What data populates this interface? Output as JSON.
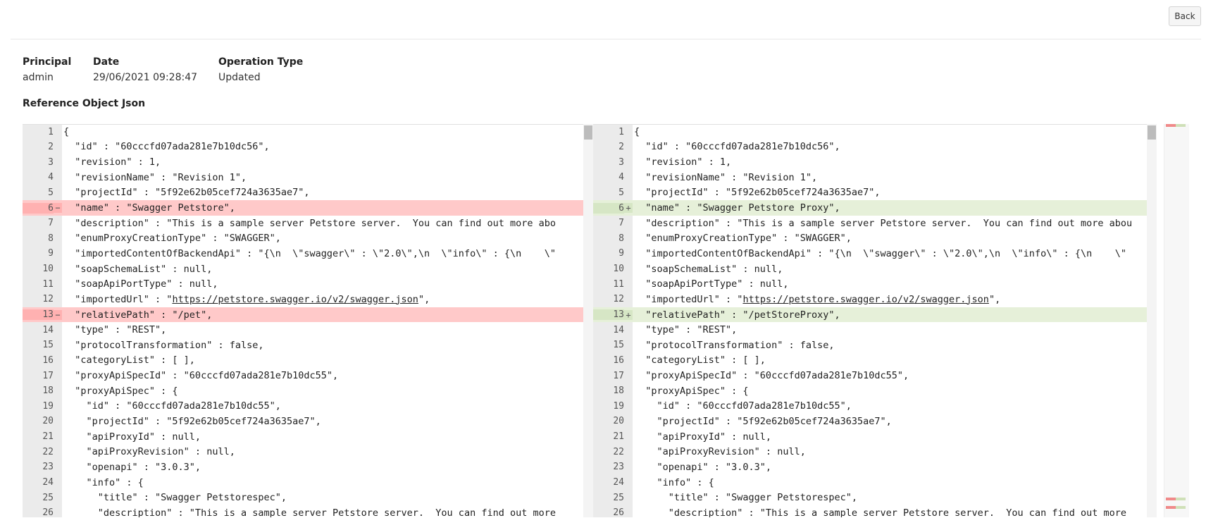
{
  "header": {
    "back_label": "Back"
  },
  "meta": {
    "principal_label": "Principal",
    "principal_value": "admin",
    "date_label": "Date",
    "date_value": "29/06/2021 09:28:47",
    "op_label": "Operation Type",
    "op_value": "Updated"
  },
  "section_title": "Reference Object Json",
  "colors": {
    "removed_bg": "#ffc9c9",
    "added_bg": "#e6f0d9",
    "gutter_bg": "#ebebeb"
  },
  "diff": {
    "left": [
      {
        "n": "1",
        "code": "{",
        "state": ""
      },
      {
        "n": "2",
        "code": "  \"id\" : \"60cccfd07ada281e7b10dc56\",",
        "state": ""
      },
      {
        "n": "3",
        "code": "  \"revision\" : 1,",
        "state": ""
      },
      {
        "n": "4",
        "code": "  \"revisionName\" : \"Revision 1\",",
        "state": ""
      },
      {
        "n": "5",
        "code": "  \"projectId\" : \"5f92e62b05cef724a3635ae7\",",
        "state": ""
      },
      {
        "n": "6",
        "code": "  \"name\" : \"Swagger Petstore\",",
        "state": "removed"
      },
      {
        "n": "7",
        "code": "  \"description\" : \"This is a sample server Petstore server.  You can find out more abo",
        "state": ""
      },
      {
        "n": "8",
        "code": "  \"enumProxyCreationType\" : \"SWAGGER\",",
        "state": ""
      },
      {
        "n": "9",
        "code": "  \"importedContentOfBackendApi\" : \"{\\n  \\\"swagger\\\" : \\\"2.0\\\",\\n  \\\"info\\\" : {\\n    \\\"",
        "state": ""
      },
      {
        "n": "10",
        "code": "  \"soapSchemaList\" : null,",
        "state": ""
      },
      {
        "n": "11",
        "code": "  \"soapApiPortType\" : null,",
        "state": ""
      },
      {
        "n": "12",
        "code": "  \"importedUrl\" : \"https://petstore.swagger.io/v2/swagger.json\",",
        "state": ""
      },
      {
        "n": "13",
        "code": "  \"relativePath\" : \"/pet\",",
        "state": "removed"
      },
      {
        "n": "14",
        "code": "  \"type\" : \"REST\",",
        "state": ""
      },
      {
        "n": "15",
        "code": "  \"protocolTransformation\" : false,",
        "state": ""
      },
      {
        "n": "16",
        "code": "  \"categoryList\" : [ ],",
        "state": ""
      },
      {
        "n": "17",
        "code": "  \"proxyApiSpecId\" : \"60cccfd07ada281e7b10dc55\",",
        "state": ""
      },
      {
        "n": "18",
        "code": "  \"proxyApiSpec\" : {",
        "state": ""
      },
      {
        "n": "19",
        "code": "    \"id\" : \"60cccfd07ada281e7b10dc55\",",
        "state": ""
      },
      {
        "n": "20",
        "code": "    \"projectId\" : \"5f92e62b05cef724a3635ae7\",",
        "state": ""
      },
      {
        "n": "21",
        "code": "    \"apiProxyId\" : null,",
        "state": ""
      },
      {
        "n": "22",
        "code": "    \"apiProxyRevision\" : null,",
        "state": ""
      },
      {
        "n": "23",
        "code": "    \"openapi\" : \"3.0.3\",",
        "state": ""
      },
      {
        "n": "24",
        "code": "    \"info\" : {",
        "state": ""
      },
      {
        "n": "25",
        "code": "      \"title\" : \"Swagger Petstorespec\",",
        "state": ""
      },
      {
        "n": "26",
        "code": "      \"description\" : \"This is a sample server Petstore server.  You can find out more",
        "state": ""
      }
    ],
    "right": [
      {
        "n": "1",
        "code": "{",
        "state": ""
      },
      {
        "n": "2",
        "code": "  \"id\" : \"60cccfd07ada281e7b10dc56\",",
        "state": ""
      },
      {
        "n": "3",
        "code": "  \"revision\" : 1,",
        "state": ""
      },
      {
        "n": "4",
        "code": "  \"revisionName\" : \"Revision 1\",",
        "state": ""
      },
      {
        "n": "5",
        "code": "  \"projectId\" : \"5f92e62b05cef724a3635ae7\",",
        "state": ""
      },
      {
        "n": "6",
        "code": "  \"name\" : \"Swagger Petstore Proxy\",",
        "state": "added"
      },
      {
        "n": "7",
        "code": "  \"description\" : \"This is a sample server Petstore server.  You can find out more abou",
        "state": ""
      },
      {
        "n": "8",
        "code": "  \"enumProxyCreationType\" : \"SWAGGER\",",
        "state": ""
      },
      {
        "n": "9",
        "code": "  \"importedContentOfBackendApi\" : \"{\\n  \\\"swagger\\\" : \\\"2.0\\\",\\n  \\\"info\\\" : {\\n    \\\"",
        "state": ""
      },
      {
        "n": "10",
        "code": "  \"soapSchemaList\" : null,",
        "state": ""
      },
      {
        "n": "11",
        "code": "  \"soapApiPortType\" : null,",
        "state": ""
      },
      {
        "n": "12",
        "code": "  \"importedUrl\" : \"https://petstore.swagger.io/v2/swagger.json\",",
        "state": ""
      },
      {
        "n": "13",
        "code": "  \"relativePath\" : \"/petStoreProxy\",",
        "state": "added"
      },
      {
        "n": "14",
        "code": "  \"type\" : \"REST\",",
        "state": ""
      },
      {
        "n": "15",
        "code": "  \"protocolTransformation\" : false,",
        "state": ""
      },
      {
        "n": "16",
        "code": "  \"categoryList\" : [ ],",
        "state": ""
      },
      {
        "n": "17",
        "code": "  \"proxyApiSpecId\" : \"60cccfd07ada281e7b10dc55\",",
        "state": ""
      },
      {
        "n": "18",
        "code": "  \"proxyApiSpec\" : {",
        "state": ""
      },
      {
        "n": "19",
        "code": "    \"id\" : \"60cccfd07ada281e7b10dc55\",",
        "state": ""
      },
      {
        "n": "20",
        "code": "    \"projectId\" : \"5f92e62b05cef724a3635ae7\",",
        "state": ""
      },
      {
        "n": "21",
        "code": "    \"apiProxyId\" : null,",
        "state": ""
      },
      {
        "n": "22",
        "code": "    \"apiProxyRevision\" : null,",
        "state": ""
      },
      {
        "n": "23",
        "code": "    \"openapi\" : \"3.0.3\",",
        "state": ""
      },
      {
        "n": "24",
        "code": "    \"info\" : {",
        "state": ""
      },
      {
        "n": "25",
        "code": "      \"title\" : \"Swagger Petstorespec\",",
        "state": ""
      },
      {
        "n": "26",
        "code": "      \"description\" : \"This is a sample server Petstore server.  You can find out more",
        "state": ""
      }
    ]
  }
}
